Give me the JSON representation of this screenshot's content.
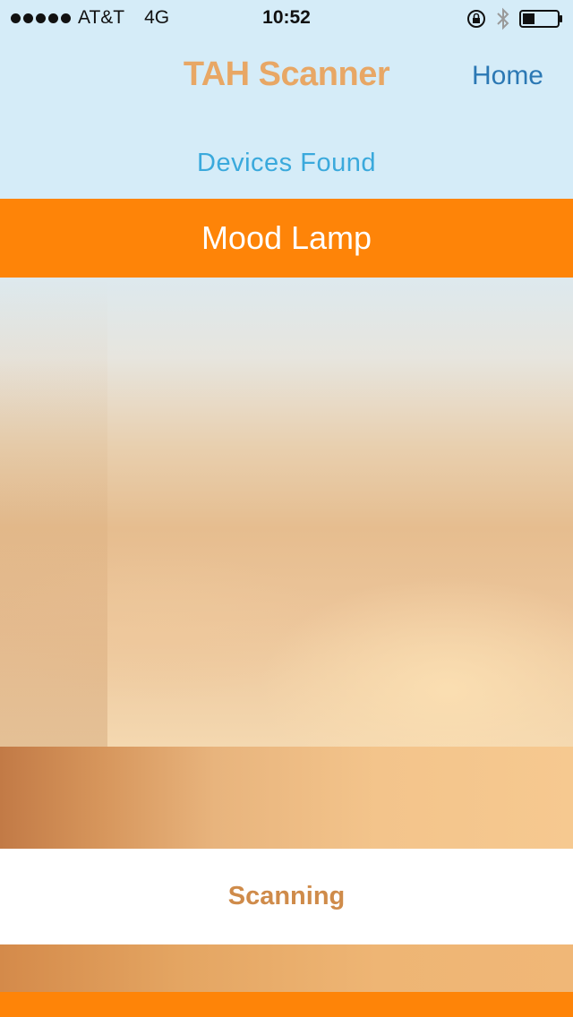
{
  "status_bar": {
    "carrier": "AT&T",
    "network": "4G",
    "time": "10:52",
    "icons": [
      "signal-dots-icon",
      "rotation-lock-icon",
      "bluetooth-icon",
      "battery-icon"
    ],
    "battery_level": 0.35
  },
  "header": {
    "title": "TAH Scanner",
    "home_label": "Home",
    "section_label": "Devices Found"
  },
  "devices": [
    {
      "name": "Mood Lamp"
    }
  ],
  "scan_button": {
    "label": "Scanning"
  },
  "colors": {
    "header_bg": "#d5ecf8",
    "title_color": "#e8a765",
    "home_color": "#2b78b4",
    "section_label_color": "#3aa9dc",
    "device_row_bg": "#fe8408",
    "scan_text_color": "#cf8b4a"
  }
}
